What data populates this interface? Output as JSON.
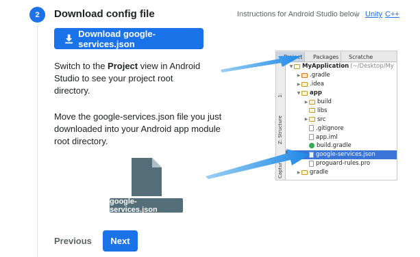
{
  "step": {
    "number": "2",
    "title": "Download config file"
  },
  "instructions": {
    "text": "Instructions for Android Studio below",
    "separator": "|",
    "links": [
      "Unity",
      "C++"
    ]
  },
  "download_button": {
    "label": "Download google-services.json",
    "icon": "download-icon"
  },
  "paragraph1": {
    "before": "Switch to the ",
    "bold": "Project",
    "after": " view in Android Studio to see your project root directory."
  },
  "paragraph2": "Move the google-services.json file you just downloaded into your Android app module root directory.",
  "file_chip": "google-services.json",
  "nav": {
    "previous": "Previous",
    "next": "Next"
  },
  "android_studio": {
    "tabs": [
      "Project",
      "Packages",
      "Scratche"
    ],
    "side_labels": [
      "1:",
      "Z: Structure",
      "Captures"
    ],
    "tree": [
      {
        "indent": 0,
        "twisty": "down",
        "icon": "module",
        "label": "MyApplication",
        "suffix": "(~/Desktop/My",
        "bold": true
      },
      {
        "indent": 1,
        "twisty": "right",
        "icon": "folder-orange",
        "label": ".gradle",
        "suffix": "",
        "bold": false
      },
      {
        "indent": 1,
        "twisty": "right",
        "icon": "folder",
        "label": ".idea",
        "suffix": "",
        "bold": false
      },
      {
        "indent": 1,
        "twisty": "down",
        "icon": "module",
        "label": "app",
        "suffix": "",
        "bold": true
      },
      {
        "indent": 2,
        "twisty": "right",
        "icon": "folder",
        "label": "build",
        "suffix": "",
        "bold": false
      },
      {
        "indent": 2,
        "twisty": "none",
        "icon": "folder",
        "label": "libs",
        "suffix": "",
        "bold": false
      },
      {
        "indent": 2,
        "twisty": "right",
        "icon": "folder",
        "label": "src",
        "suffix": "",
        "bold": false
      },
      {
        "indent": 2,
        "twisty": "none",
        "icon": "file",
        "label": ".gitignore",
        "suffix": "",
        "bold": false
      },
      {
        "indent": 2,
        "twisty": "none",
        "icon": "file",
        "label": "app.iml",
        "suffix": "",
        "bold": false
      },
      {
        "indent": 2,
        "twisty": "none",
        "icon": "gradle",
        "label": "build.gradle",
        "suffix": "",
        "bold": false
      },
      {
        "indent": 2,
        "twisty": "none",
        "icon": "json",
        "label": "google-services.json",
        "suffix": "",
        "bold": false,
        "selected": true
      },
      {
        "indent": 2,
        "twisty": "none",
        "icon": "file",
        "label": "proguard-rules.pro",
        "suffix": "",
        "bold": false
      },
      {
        "indent": 1,
        "twisty": "right",
        "icon": "folder",
        "label": "gradle",
        "suffix": "",
        "bold": false
      }
    ]
  },
  "colors": {
    "primary": "#1a73e8",
    "chip": "#546e7a",
    "arrow": "#2196f3",
    "selection": "#3875d7"
  }
}
